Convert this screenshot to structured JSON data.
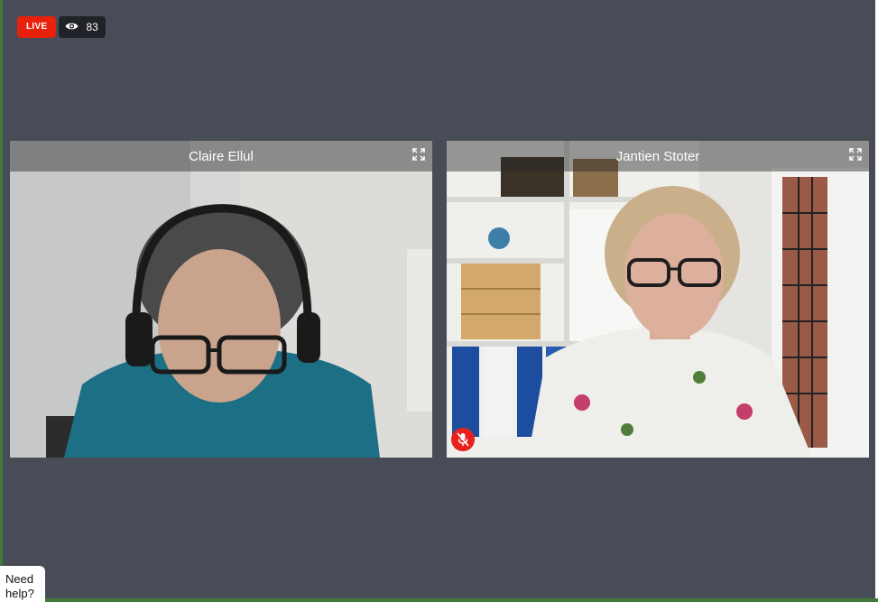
{
  "stream": {
    "live_label": "LIVE",
    "viewer_count": "83",
    "viewer_icon": "eye-icon"
  },
  "participants": [
    {
      "name": "Claire Ellul",
      "muted": false
    },
    {
      "name": "Jantien Stoter",
      "muted": true
    }
  ],
  "help": {
    "line1": "Need",
    "line2": "help?"
  },
  "colors": {
    "stage_bg": "#484c57",
    "live_red": "#e8210d",
    "mute_red": "#e8211d"
  }
}
